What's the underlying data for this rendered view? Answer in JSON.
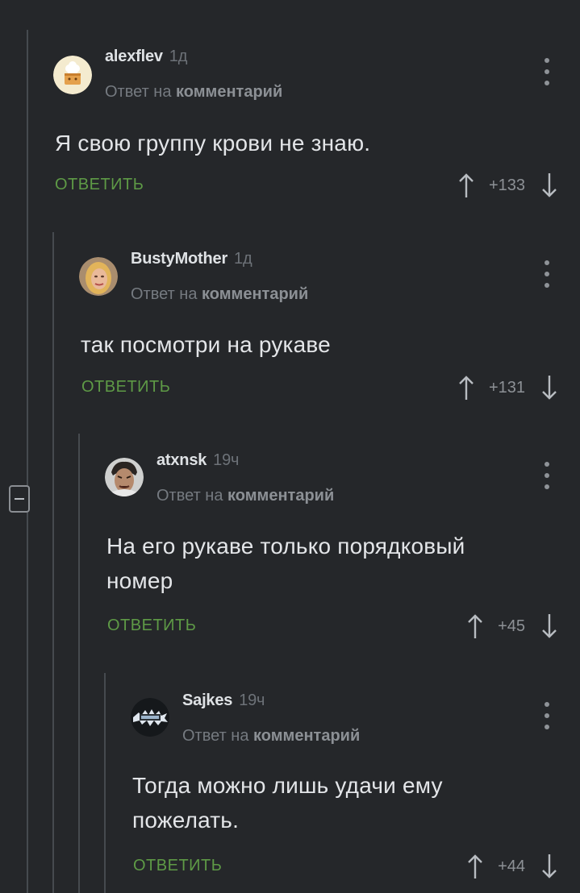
{
  "comments": [
    {
      "username": "alexflev",
      "time": "1д",
      "reply_prefix": "Ответ на",
      "reply_target": "комментарий",
      "text": "Я свою группу крови не знаю.",
      "reply_label": "ОТВЕТИТЬ",
      "rating": "+133",
      "avatar": "chef-hat-avatar"
    },
    {
      "username": "BustyMother",
      "time": "1д",
      "reply_prefix": "Ответ на",
      "reply_target": "комментарий",
      "text": "так посмотри на рукаве",
      "reply_label": "ОТВЕТИТЬ",
      "rating": "+131",
      "avatar": "photo-avatar"
    },
    {
      "username": "atxnsk",
      "time": "19ч",
      "reply_prefix": "Ответ на",
      "reply_target": "комментарий",
      "text_lines": [
        "На его рукаве только порядковый",
        "номер"
      ],
      "reply_label": "ОТВЕТИТЬ",
      "rating": "+45",
      "avatar": "face-avatar"
    },
    {
      "username": "Sajkes",
      "time": "19ч",
      "reply_prefix": "Ответ на",
      "reply_target": "комментарий",
      "text_lines": [
        "Тогда можно лишь удачи ему",
        "пожелать."
      ],
      "reply_label": "ОТВЕТИТЬ",
      "rating": "+44",
      "avatar": "logo-avatar"
    }
  ],
  "colors": {
    "background": "#25272a",
    "reply_accent": "#5e9a46",
    "thread_line": "#464a4f"
  },
  "icons": [
    "vote-up-icon",
    "vote-down-icon",
    "more-options-icon",
    "collapse-thread-icon"
  ]
}
